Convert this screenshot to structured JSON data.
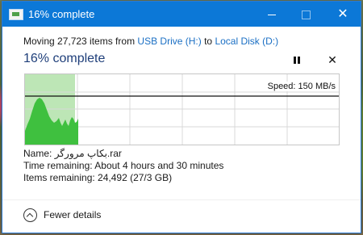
{
  "window": {
    "title": "16% complete",
    "controls": {
      "minimize_icon": "minimize-icon",
      "maximize_icon": "maximize-icon",
      "close_icon": "close-icon"
    }
  },
  "transfer": {
    "moving_prefix": "Moving 27,723 items from",
    "source": "USB Drive (H:)",
    "to_word": "to",
    "destination": "Local Disk (D:)",
    "heading": "16% complete",
    "progress_percent": 16
  },
  "graph": {
    "speed_text": "Speed: 150 MB/s",
    "fill_color": "#3fc03f",
    "area_color": "#bde6b6"
  },
  "details": {
    "name_label": "Name:",
    "name_value": "بکاپ مرورگر.rar",
    "time_label": "Time remaining:",
    "time_value": "About 4 hours and 30 minutes",
    "items_label": "Items remaining:",
    "items_value": "24,492 (27/3 GB)"
  },
  "footer": {
    "fewer_label": "Fewer details",
    "fewer_icon": "chevron-up-circle-icon"
  },
  "colors": {
    "titlebar": "#0c78d7",
    "link": "#1a6fc4",
    "heading": "#1f3f7a"
  }
}
